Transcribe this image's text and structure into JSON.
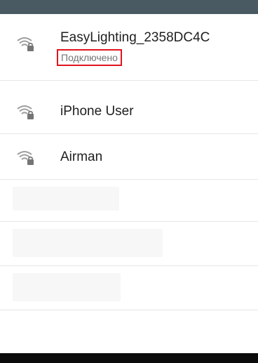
{
  "networks": [
    {
      "ssid": "EasyLighting_2358DC4C",
      "status": "Подключено",
      "icon": "wifi-lock-icon"
    },
    {
      "ssid": "iPhone User",
      "icon": "wifi-lock-icon"
    },
    {
      "ssid": "Airman",
      "icon": "wifi-lock-icon"
    }
  ],
  "colors": {
    "status_bar": "#4a5a63",
    "highlight_border": "#e0141e",
    "nav_bar": "#0b0b0b"
  }
}
